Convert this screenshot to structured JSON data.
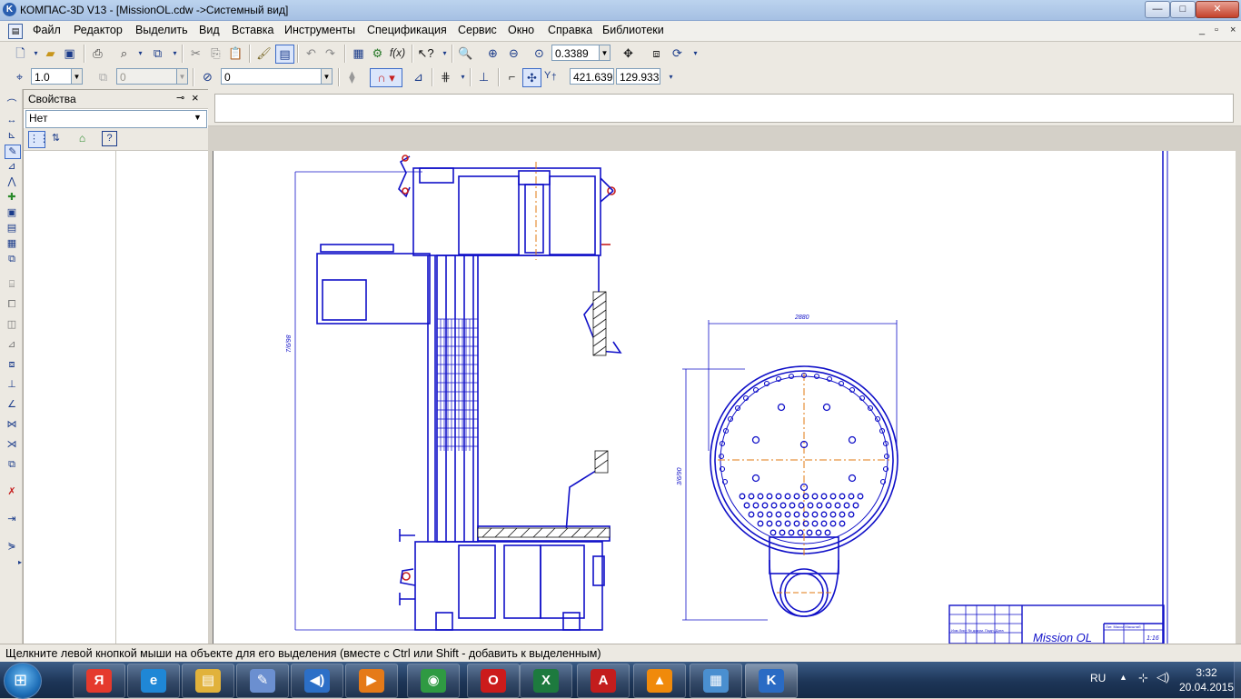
{
  "window": {
    "title": "КОМПАС-3D V13 - [MissionOL.cdw ->Системный вид]",
    "app_icon": "kompas-k-icon",
    "controls": {
      "minimize": "—",
      "maximize": "□",
      "close": "✕"
    }
  },
  "menu": {
    "items": [
      "Файл",
      "Редактор",
      "Выделить",
      "Вид",
      "Вставка",
      "Инструменты",
      "Спецификация",
      "Сервис",
      "Окно",
      "Справка",
      "Библиотеки"
    ],
    "mdi_controls": {
      "minimize": "_",
      "restore": "▫",
      "close": "×"
    }
  },
  "toolbar_standard": {
    "zoom_value": "0.3389"
  },
  "toolbar_current": {
    "style_value": "1.0",
    "layer_value": "0",
    "view_value": "0",
    "coord_x": "421.639",
    "coord_y": "129.933",
    "coord_label": "Y"
  },
  "properties_panel": {
    "title": "Свойства",
    "pin": "ₔ",
    "close": "×",
    "selection_value": "Нет"
  },
  "drawing": {
    "dim_height_left": "7/6/98",
    "dim_width_right": "2880",
    "dim_height_right": "3/6/90",
    "title_block_name": "Mission OL",
    "title_block_scale": "1:16",
    "title_block_row": "Изм Лист № докум. Подп. Дата",
    "title_block_cols": "Лит. Масса Масштаб"
  },
  "status": {
    "text": "Щелкните левой кнопкой мыши на объекте для его выделения (вместе с Ctrl или Shift - добавить к выделенным)"
  },
  "taskbar": {
    "apps": [
      {
        "name": "yandex",
        "glyph": "Я",
        "color": "#e53a2d"
      },
      {
        "name": "internet-explorer",
        "glyph": "e",
        "color": "#1f87d6"
      },
      {
        "name": "explorer",
        "glyph": "▤",
        "color": "#e1b23b"
      },
      {
        "name": "paint",
        "glyph": "✎",
        "color": "#6b8fd0"
      },
      {
        "name": "media-player",
        "glyph": "◀)",
        "color": "#2c6fc7"
      },
      {
        "name": "video-player",
        "glyph": "▶",
        "color": "#e57a18"
      },
      {
        "name": "chrome",
        "glyph": "◉",
        "color": "#2f9a42"
      },
      {
        "name": "opera",
        "glyph": "O",
        "color": "#cc1b1b"
      },
      {
        "name": "excel",
        "glyph": "X",
        "color": "#1d7a3e"
      },
      {
        "name": "acrobat",
        "glyph": "A",
        "color": "#c31d1d"
      },
      {
        "name": "vlc",
        "glyph": "▲",
        "color": "#f08a0b"
      },
      {
        "name": "control-panel",
        "glyph": "▦",
        "color": "#4a8fd0"
      },
      {
        "name": "kompas",
        "glyph": "K",
        "color": "#2a6bc4"
      }
    ],
    "language": "RU",
    "time": "3:32",
    "date": "20.04.2015"
  }
}
